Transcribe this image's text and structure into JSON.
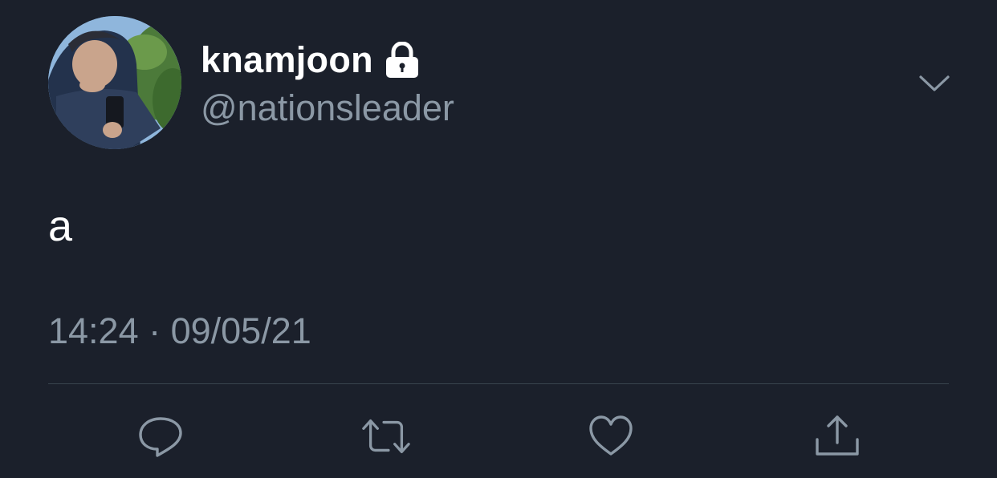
{
  "tweet": {
    "display_name": "knamjoon",
    "handle": "@nationsleader",
    "text": "a",
    "timestamp": "14:24 · 09/05/21",
    "protected_icon": "lock-icon",
    "menu_icon": "chevron-down-icon"
  },
  "actions": [
    {
      "name": "reply",
      "icon": "reply-icon"
    },
    {
      "name": "retweet",
      "icon": "retweet-icon"
    },
    {
      "name": "like",
      "icon": "heart-icon"
    },
    {
      "name": "share",
      "icon": "share-icon"
    }
  ],
  "colors": {
    "background": "#1b202b",
    "primary_text": "#ffffff",
    "secondary_text": "#8b98a5",
    "divider": "#38444d",
    "icon": "#8b98a5"
  }
}
